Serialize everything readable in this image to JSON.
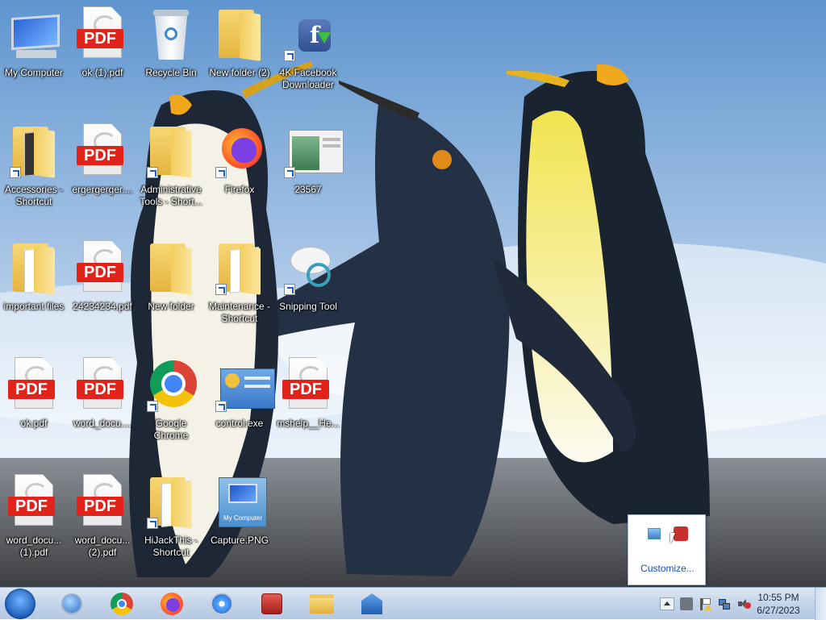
{
  "desktop": {
    "icons": [
      {
        "label": "My Computer",
        "icon": "computer-icon"
      },
      {
        "label": "ok (1).pdf",
        "icon": "pdf-file-icon"
      },
      {
        "label": "Recycle Bin",
        "icon": "recycle-bin-icon"
      },
      {
        "label": "New folder (2)",
        "icon": "folder-icon"
      },
      {
        "label": "4K Facebook\nDownloader",
        "icon": "facebook-downloader-icon"
      },
      {
        "label": "Accessories -\nShortcut",
        "icon": "folder-icon"
      },
      {
        "label": "ergergerger....",
        "icon": "pdf-file-icon"
      },
      {
        "label": "Administrative\nTools - Short...",
        "icon": "folder-icon"
      },
      {
        "label": "Firefox",
        "icon": "firefox-icon"
      },
      {
        "label": "23567",
        "icon": "image-file-icon"
      },
      {
        "label": "important files",
        "icon": "folder-icon"
      },
      {
        "label": "24234234.pdf",
        "icon": "pdf-file-icon"
      },
      {
        "label": "New folder",
        "icon": "folder-icon"
      },
      {
        "label": "Maintenance -\nShortcut",
        "icon": "folder-icon"
      },
      {
        "label": "Snipping Tool",
        "icon": "scissors-icon"
      },
      {
        "label": "ok.pdf",
        "icon": "pdf-file-icon"
      },
      {
        "label": "word_docu....",
        "icon": "pdf-file-icon"
      },
      {
        "label": "Google\nChrome",
        "icon": "chrome-icon"
      },
      {
        "label": "control.exe",
        "icon": "control-panel-icon"
      },
      {
        "label": "mshelp__He...",
        "icon": "pdf-file-icon"
      },
      {
        "label": "word_docu...\n(1).pdf",
        "icon": "pdf-file-icon"
      },
      {
        "label": "word_docu...\n(2).pdf",
        "icon": "pdf-file-icon"
      },
      {
        "label": "HiJackThis -\nShortcut",
        "icon": "folder-icon"
      },
      {
        "label": "Capture.PNG",
        "icon": "image-file-icon"
      }
    ],
    "pdf_badge": "PDF",
    "capture_caption": "My Computer"
  },
  "taskbar": {
    "start": "start-orb-icon",
    "pinned": [
      {
        "icon": "network-globe-icon"
      },
      {
        "icon": "chrome-icon"
      },
      {
        "icon": "firefox-icon"
      },
      {
        "icon": "safari-compass-icon"
      },
      {
        "icon": "security-app-icon"
      },
      {
        "icon": "file-explorer-icon"
      },
      {
        "icon": "installer-app-icon"
      }
    ],
    "tray_icons": [
      "show-hidden-icons-arrow",
      "printer-icon",
      "action-center-flag-icon",
      "network-icon",
      "volume-muted-icon"
    ],
    "clock": {
      "time": "10:55 PM",
      "date": "6/27/2023"
    }
  },
  "tray_popup": {
    "icons": [
      "monitor-app-icon",
      "red-app-icon"
    ],
    "customize_label": "Customize..."
  },
  "colors": {
    "pdf_red": "#e2231a",
    "link_blue": "#1a4fb3",
    "taskbar": "#c4d4ea"
  }
}
